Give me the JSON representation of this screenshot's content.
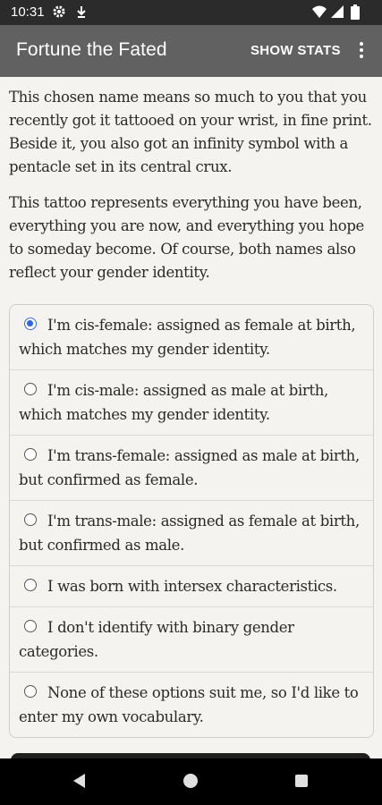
{
  "status_bar": {
    "time": "10:31"
  },
  "app_bar": {
    "title": "Fortune the Fated",
    "show_stats_label": "SHOW STATS"
  },
  "story": {
    "paragraphs": [
      "This chosen name means so much to you that you recently got it tattooed on your wrist, in fine print. Beside it, you also got an infinity symbol with a pentacle set in its central crux.",
      "This tattoo represents everything you have been, everything you are now, and everything you hope to someday become. Of course, both names also reflect your gender identity."
    ]
  },
  "choices": [
    {
      "label": "I'm cis-female: assigned as female at birth, which matches my gender identity.",
      "selected": true
    },
    {
      "label": "I'm cis-male: assigned as male at birth, which matches my gender identity.",
      "selected": false
    },
    {
      "label": "I'm trans-female: assigned as male at birth, but confirmed as female.",
      "selected": false
    },
    {
      "label": "I'm trans-male: assigned as female at birth, but confirmed as male.",
      "selected": false
    },
    {
      "label": "I was born with intersex characteristics.",
      "selected": false
    },
    {
      "label": "I don't identify with binary gender categories.",
      "selected": false
    },
    {
      "label": "None of these options suit me, so I'd like to enter my own vocabulary.",
      "selected": false
    }
  ],
  "colors": {
    "app_bar": "#616161",
    "status_bar": "#2b2b2b",
    "background": "#f5f3ef",
    "radio_accent": "#2f66d8"
  },
  "icons": {
    "status": [
      "settings-icon",
      "download-icon",
      "wifi-icon",
      "signal-icon",
      "battery-icon"
    ],
    "app_bar": [
      "more-vert-icon"
    ],
    "nav": [
      "back-icon",
      "home-icon",
      "recents-icon"
    ]
  }
}
